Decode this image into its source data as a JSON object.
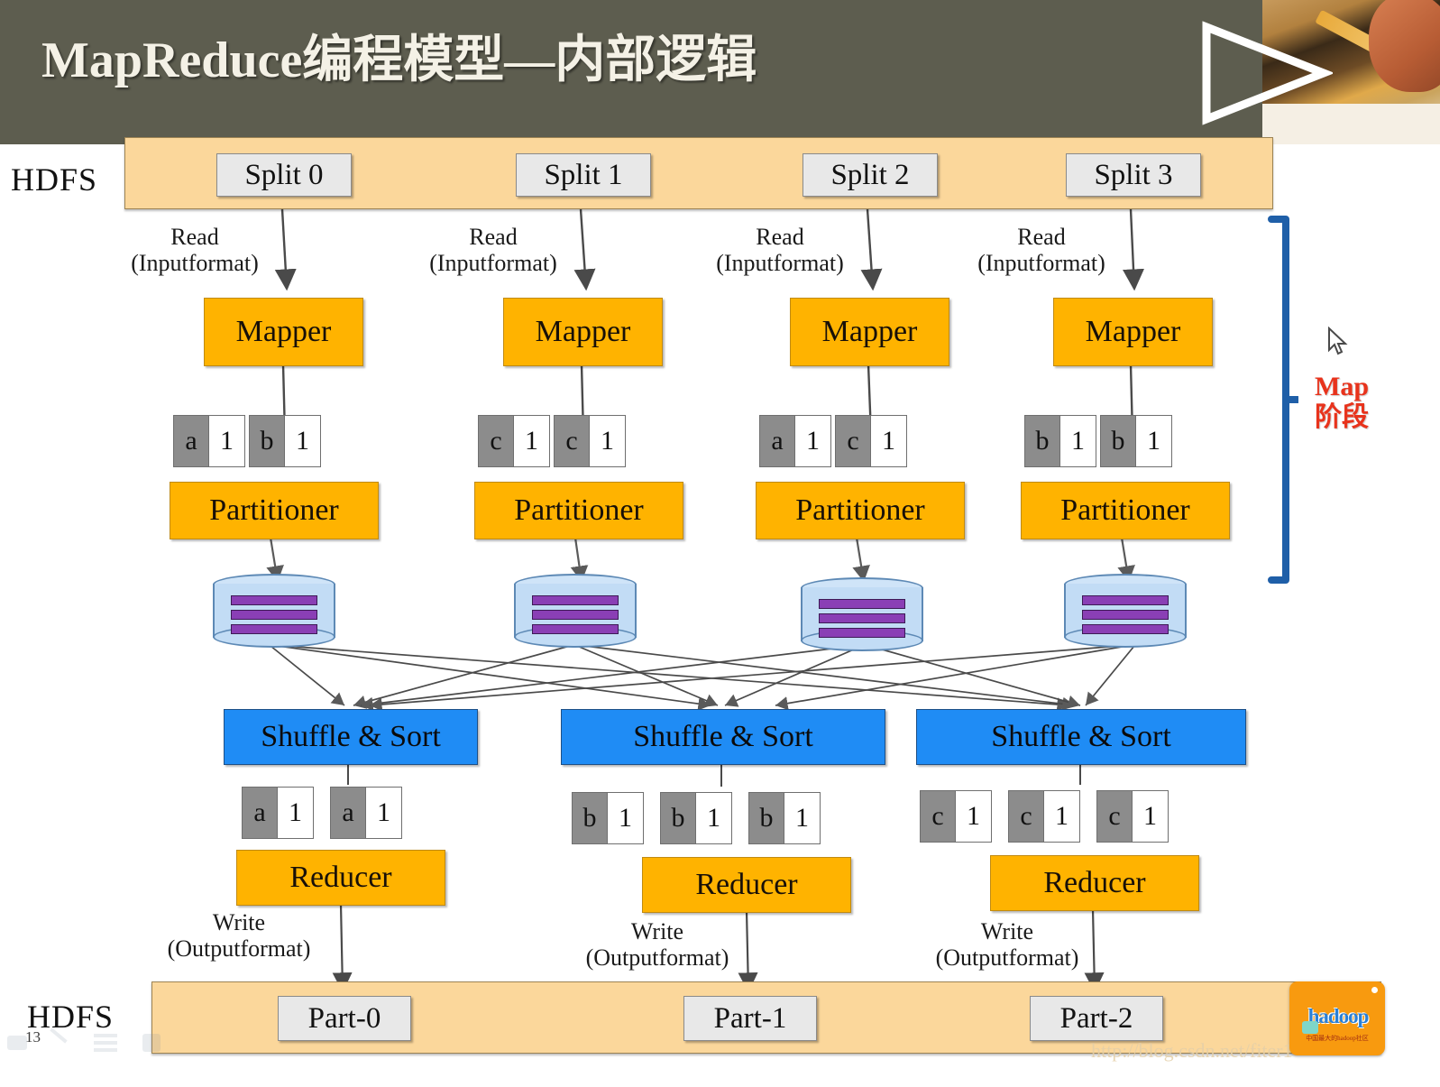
{
  "header": {
    "title": "MapReduce编程模型—内部逻辑",
    "play_icon": "play-triangle-icon"
  },
  "hdfs": {
    "top_label": "HDFS",
    "bottom_label": "HDFS"
  },
  "splits": [
    {
      "label": "Split  0"
    },
    {
      "label": "Split  1"
    },
    {
      "label": "Split  2"
    },
    {
      "label": "Split  3"
    }
  ],
  "read_labels": [
    {
      "line1": "Read",
      "line2": "(Inputformat)"
    },
    {
      "line1": "Read",
      "line2": "(Inputformat)"
    },
    {
      "line1": "Read",
      "line2": "(Inputformat)"
    },
    {
      "line1": "Read",
      "line2": "(Inputformat)"
    }
  ],
  "mappers": [
    {
      "label": "Mapper"
    },
    {
      "label": "Mapper"
    },
    {
      "label": "Mapper"
    },
    {
      "label": "Mapper"
    }
  ],
  "mapper_outputs": [
    {
      "pairs": [
        {
          "key": "a",
          "value": "1"
        },
        {
          "key": "b",
          "value": "1"
        }
      ]
    },
    {
      "pairs": [
        {
          "key": "c",
          "value": "1"
        },
        {
          "key": "c",
          "value": "1"
        }
      ]
    },
    {
      "pairs": [
        {
          "key": "a",
          "value": "1"
        },
        {
          "key": "c",
          "value": "1"
        }
      ]
    },
    {
      "pairs": [
        {
          "key": "b",
          "value": "1"
        },
        {
          "key": "b",
          "value": "1"
        }
      ]
    }
  ],
  "partitioners": [
    {
      "label": "Partitioner"
    },
    {
      "label": "Partitioner"
    },
    {
      "label": "Partitioner"
    },
    {
      "label": "Partitioner"
    }
  ],
  "spill_disks": [
    {
      "name": "spill-disk-0",
      "bar_count": 3
    },
    {
      "name": "spill-disk-1",
      "bar_count": 3
    },
    {
      "name": "spill-disk-2",
      "bar_count": 3
    },
    {
      "name": "spill-disk-3",
      "bar_count": 3
    }
  ],
  "shuffles": [
    {
      "label": "Shuffle & Sort"
    },
    {
      "label": "Shuffle & Sort"
    },
    {
      "label": "Shuffle & Sort"
    }
  ],
  "reducer_inputs": [
    {
      "pairs": [
        {
          "key": "a",
          "value": "1"
        },
        {
          "key": "a",
          "value": "1"
        }
      ]
    },
    {
      "pairs": [
        {
          "key": "b",
          "value": "1"
        },
        {
          "key": "b",
          "value": "1"
        },
        {
          "key": "b",
          "value": "1"
        }
      ]
    },
    {
      "pairs": [
        {
          "key": "c",
          "value": "1"
        },
        {
          "key": "c",
          "value": "1"
        },
        {
          "key": "c",
          "value": "1"
        }
      ]
    }
  ],
  "reducers": [
    {
      "label": "Reducer"
    },
    {
      "label": "Reducer"
    },
    {
      "label": "Reducer"
    }
  ],
  "write_labels": [
    {
      "line1": "Write",
      "line2": "(Outputformat)"
    },
    {
      "line1": "Write",
      "line2": "(Outputformat)"
    },
    {
      "line1": "Write",
      "line2": "(Outputformat)"
    }
  ],
  "parts": [
    {
      "label": "Part-0"
    },
    {
      "label": "Part-1"
    },
    {
      "label": "Part-2"
    }
  ],
  "phase_annotation": {
    "line1": "Map",
    "line2": "阶段",
    "color": "#e8331c"
  },
  "footer": {
    "slide_number": "13",
    "watermark": "http://blog.csdn.net/fiter1",
    "logo_word": "hadoop",
    "logo_sub": "中国最大的hadoop社区"
  },
  "colors": {
    "header_band": "#5d5d4f",
    "hdfs_bar": "#fbd79b",
    "amber_box": "#ffb300",
    "shuffle_box": "#1f8cf5",
    "key_chip": "#8c8c8c",
    "value_chip": "#ffffff",
    "cylinder": "#c2dcf5",
    "cylinder_bar": "#8a3fb5",
    "bracket": "#1f5fa8",
    "phase_text": "#e8331c"
  }
}
